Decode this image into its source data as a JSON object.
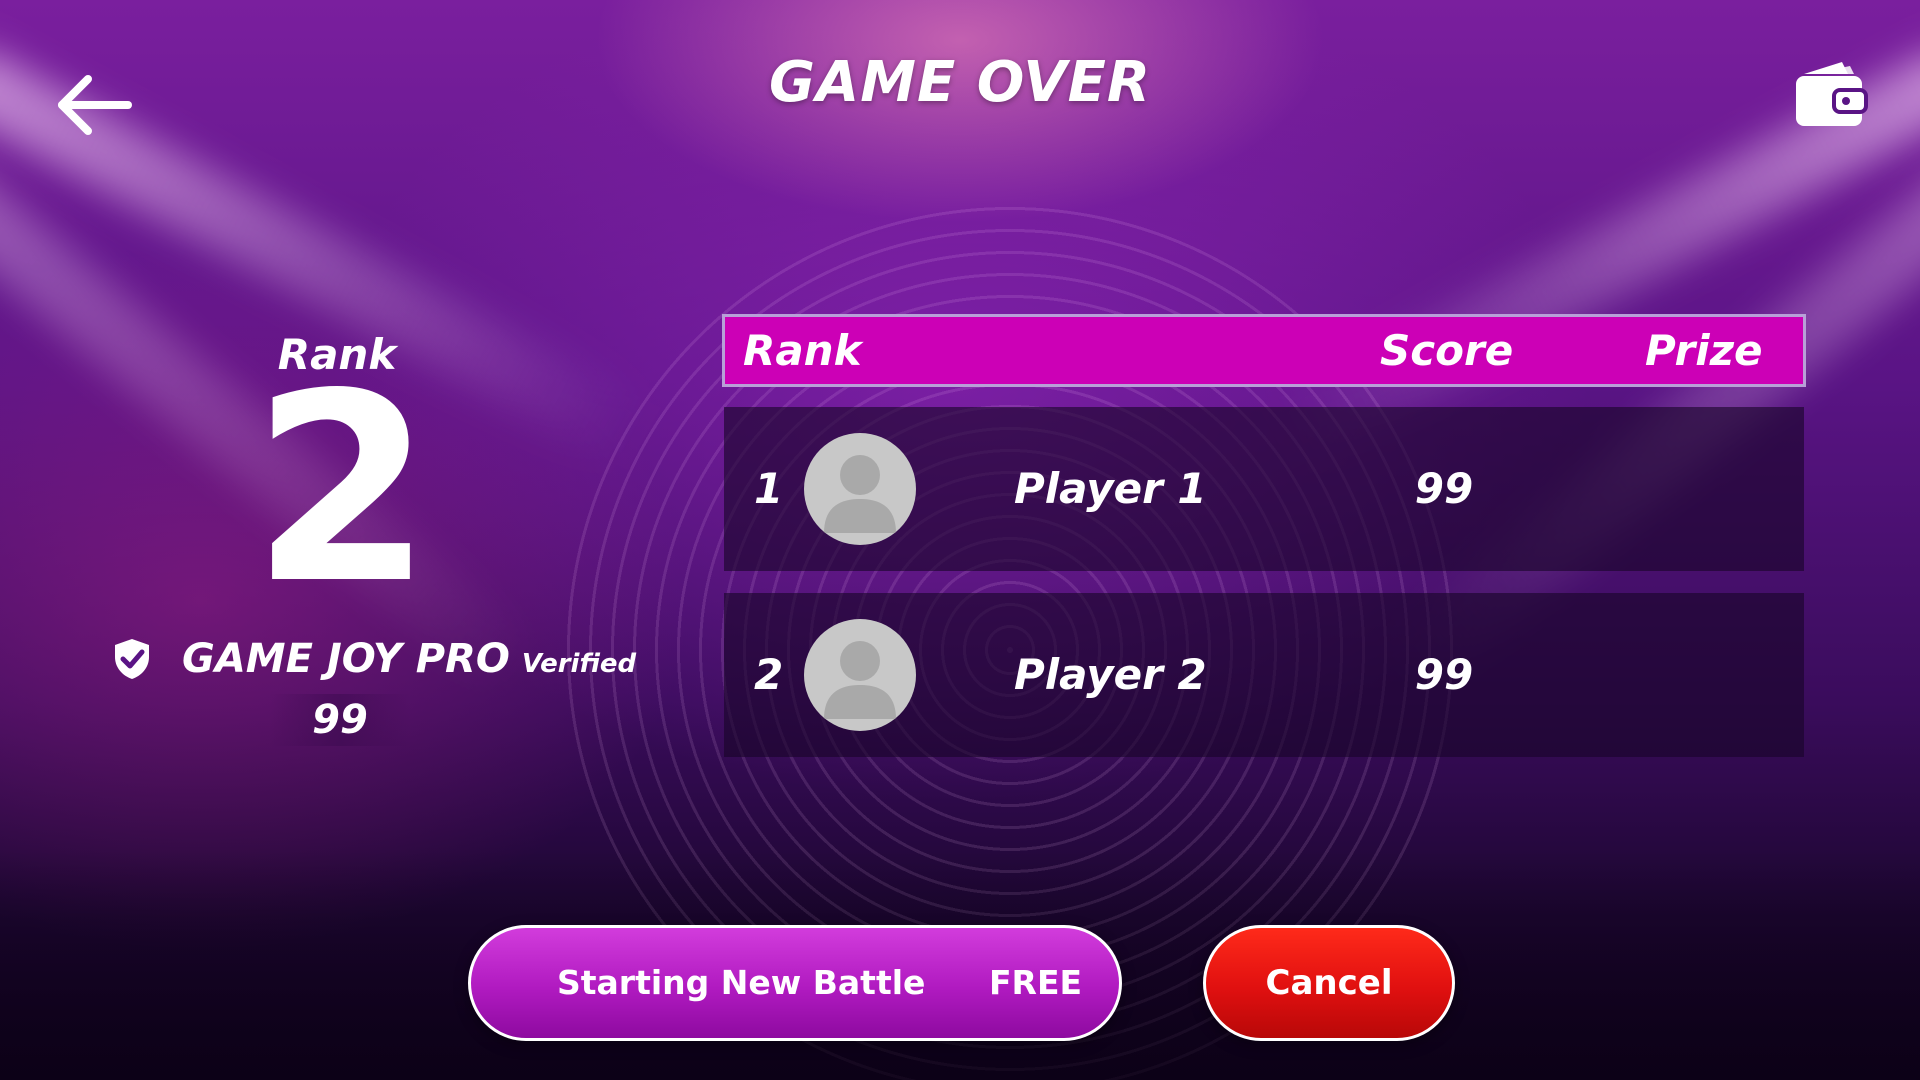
{
  "screen": {
    "title": "GAME OVER",
    "back_icon": "arrow-left-icon",
    "wallet_icon": "wallet-icon"
  },
  "result": {
    "rank_label": "Rank",
    "rank_value": "2",
    "player_name": "GAME JOY PRO",
    "verified_label": "Verified",
    "score": "99",
    "badge_icon": "shield-check-icon"
  },
  "leaderboard": {
    "headers": {
      "rank": "Rank",
      "score": "Score",
      "prize": "Prize"
    },
    "rows": [
      {
        "rank": "1",
        "name": "Player 1",
        "score": "99",
        "avatar_icon": "user-avatar-icon"
      },
      {
        "rank": "2",
        "name": "Player 2",
        "score": "99",
        "avatar_icon": "user-avatar-icon"
      }
    ]
  },
  "actions": {
    "new_battle_label": "Starting New Battle",
    "new_battle_cost": "FREE",
    "cancel_label": "Cancel"
  },
  "colors": {
    "header_bar": "#cc00b6",
    "primary_button": "#b01ac0",
    "cancel_button": "#e01010",
    "background": "#5a1485"
  }
}
